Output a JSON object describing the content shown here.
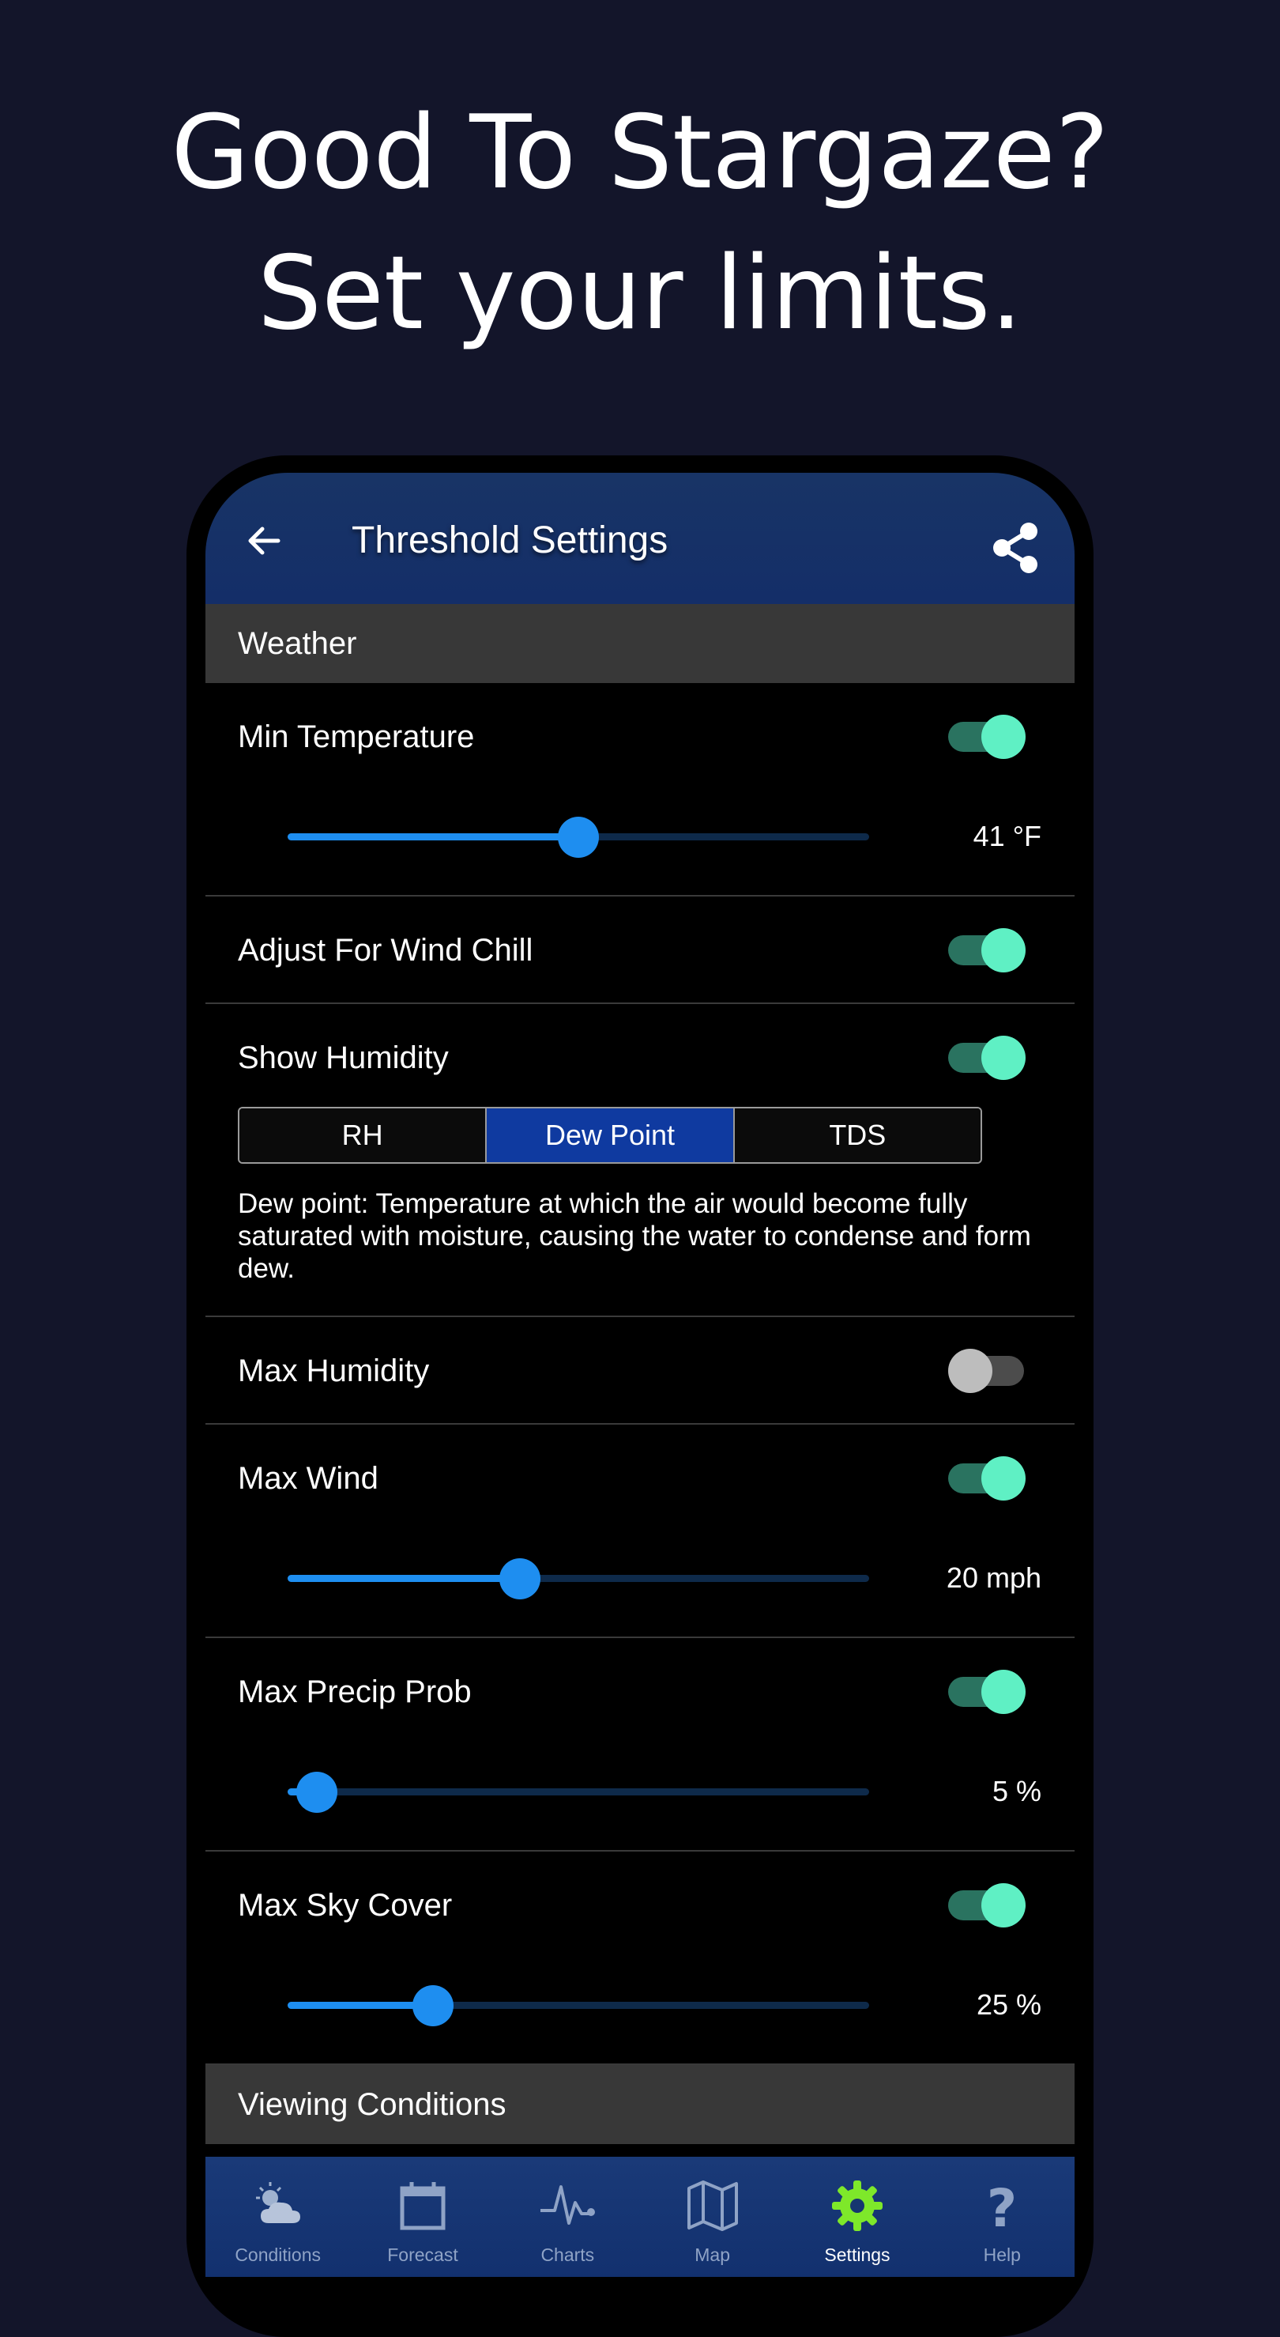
{
  "headline": {
    "line1": "Good To Stargaze?",
    "line2": "Set your limits."
  },
  "appbar": {
    "title": "Threshold Settings",
    "back_icon": "arrow-left-icon",
    "share_icon": "share-icon"
  },
  "sections": {
    "weather": "Weather",
    "viewing_conditions": "Viewing Conditions"
  },
  "settings": {
    "min_temperature": {
      "label": "Min Temperature",
      "enabled": true,
      "value_text": "41 °F",
      "level": 0.5
    },
    "wind_chill": {
      "label": "Adjust For Wind Chill",
      "enabled": true
    },
    "show_humidity": {
      "label": "Show Humidity",
      "enabled": true,
      "options": [
        "RH",
        "Dew Point",
        "TDS"
      ],
      "selected": "Dew Point",
      "description": "Dew point: Temperature at which the air would become fully saturated with moisture, causing the water to condense and form dew."
    },
    "max_humidity": {
      "label": "Max Humidity",
      "enabled": false
    },
    "max_wind": {
      "label": "Max Wind",
      "enabled": true,
      "value_text": "20 mph",
      "level": 0.4
    },
    "max_precip": {
      "label": "Max Precip Prob",
      "enabled": true,
      "value_text": "5 %",
      "level": 0.05
    },
    "max_sky_cover": {
      "label": "Max Sky Cover",
      "enabled": true,
      "value_text": "25 %",
      "level": 0.25
    }
  },
  "bottom_nav": [
    {
      "label": "Conditions",
      "icon": "cloud-sun-icon",
      "active": false
    },
    {
      "label": "Forecast",
      "icon": "calendar-icon",
      "active": false
    },
    {
      "label": "Charts",
      "icon": "pulse-chart-icon",
      "active": false
    },
    {
      "label": "Map",
      "icon": "map-icon",
      "active": false
    },
    {
      "label": "Settings",
      "icon": "gear-icon",
      "active": true
    },
    {
      "label": "Help",
      "icon": "question-icon",
      "active": false
    }
  ],
  "colors": {
    "background": "#13152a",
    "appbar": "#183466",
    "accent_blue": "#1e8ef0",
    "toggle_on": "#5ff0c4",
    "settings_active": "#7ee82a"
  }
}
